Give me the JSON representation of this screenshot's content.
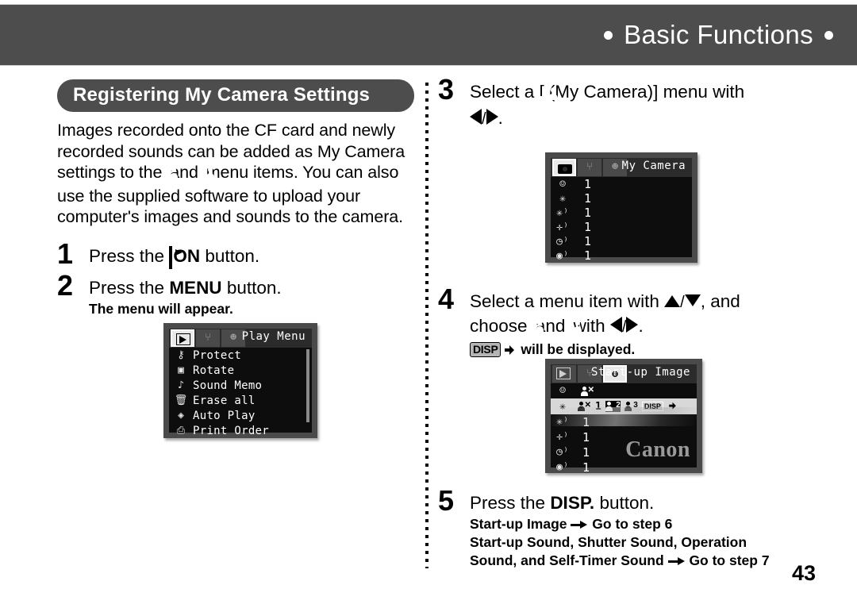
{
  "header": {
    "title": "Basic Functions",
    "bullet_left": "●",
    "bullet_right": "●",
    "band_color": "#4d4d4d"
  },
  "left_column": {
    "section_title": "Registering My Camera Settings",
    "intro_parts": {
      "p1": "Images recorded onto the CF card and newly recorded sounds can be added as My Camera settings to the",
      "icon_my2": "my-camera-2",
      "p2": "and",
      "icon_my3": "my-camera-3",
      "p3": "menu items. You can also use the supplied software to upload your computer's images and sounds to the camera."
    },
    "steps": [
      {
        "number": "1",
        "text_before": "Press the",
        "icon": "playback-on-icon",
        "bold_word": "ON",
        "text_after": "button.",
        "sub": ""
      },
      {
        "number": "2",
        "text_before": "Press the",
        "bold_word": "MENU",
        "text_after": "button.",
        "sub": "The menu will appear."
      }
    ],
    "play_menu_screen": {
      "title": "Play Menu",
      "tabs": [
        "playback-tab",
        "setup-tab",
        "my-camera-tab"
      ],
      "selected_tab": 0,
      "items": [
        {
          "icon": "key-icon",
          "label": "Protect"
        },
        {
          "icon": "rotate-icon",
          "label": "Rotate"
        },
        {
          "icon": "microphone-icon",
          "label": "Sound Memo"
        },
        {
          "icon": "trash-icon",
          "label": "Erase all"
        },
        {
          "icon": "autoplay-icon",
          "label": "Auto Play"
        },
        {
          "icon": "printer-icon",
          "label": "Print Order"
        }
      ]
    }
  },
  "right_column": {
    "steps": [
      {
        "number": "3",
        "line1_a": "Select a [",
        "icon": "my-camera-icon",
        "line1_b": "(My Camera)] menu with",
        "line2_suffix": "."
      },
      {
        "number": "4",
        "line1_a": "Select a menu item with",
        "line1_b": ", and",
        "line2_a": "choose",
        "line2_b": "and",
        "line2_c": "with",
        "line2_d": ".",
        "line3": "will be displayed.",
        "disp_label": "DISP"
      },
      {
        "number": "5",
        "text_before": "Press the",
        "bold_word": "DISP.",
        "text_after": "button.",
        "sub_lines": [
          "Start-up Image",
          "Go to step 6",
          "Start-up Sound, Shutter Sound, Operation",
          "Sound, and Self-Timer Sound",
          "Go to step 7"
        ]
      }
    ],
    "my_camera_screen": {
      "title": "My Camera",
      "tabs": [
        "camera-tab",
        "setup-tab",
        "my-camera-tab"
      ],
      "selected_tab": 0,
      "rows": [
        {
          "icon": "theme-icon",
          "value": "1"
        },
        {
          "icon": "startup-image-icon",
          "value": "1"
        },
        {
          "icon": "startup-sound-icon",
          "value": "1"
        },
        {
          "icon": "operation-sound-icon",
          "value": "1"
        },
        {
          "icon": "selftimer-sound-icon",
          "value": "1"
        },
        {
          "icon": "shutter-sound-icon",
          "value": "1"
        }
      ]
    },
    "startup_image_screen": {
      "title": "Start-up Image",
      "tabs": [
        "playback-tab",
        "setup-tab",
        "my-camera-tab"
      ],
      "selected_tab": 2,
      "watermark": "Canon",
      "rows": [
        {
          "icon": "theme-icon",
          "value": "",
          "extra": "my-camera-set"
        },
        {
          "icon": "startup-image-icon",
          "value": "1",
          "selected": true,
          "choices": [
            "my-camera-1",
            "my-camera-2",
            "my-camera-3"
          ],
          "selected_choice": 1,
          "disp": "DISP"
        },
        {
          "icon": "startup-sound-icon",
          "value": "1"
        },
        {
          "icon": "operation-sound-icon",
          "value": "1"
        },
        {
          "icon": "selftimer-sound-icon",
          "value": "1"
        },
        {
          "icon": "shutter-sound-icon",
          "value": "1"
        }
      ]
    }
  },
  "footer": {
    "page_number": "43"
  }
}
